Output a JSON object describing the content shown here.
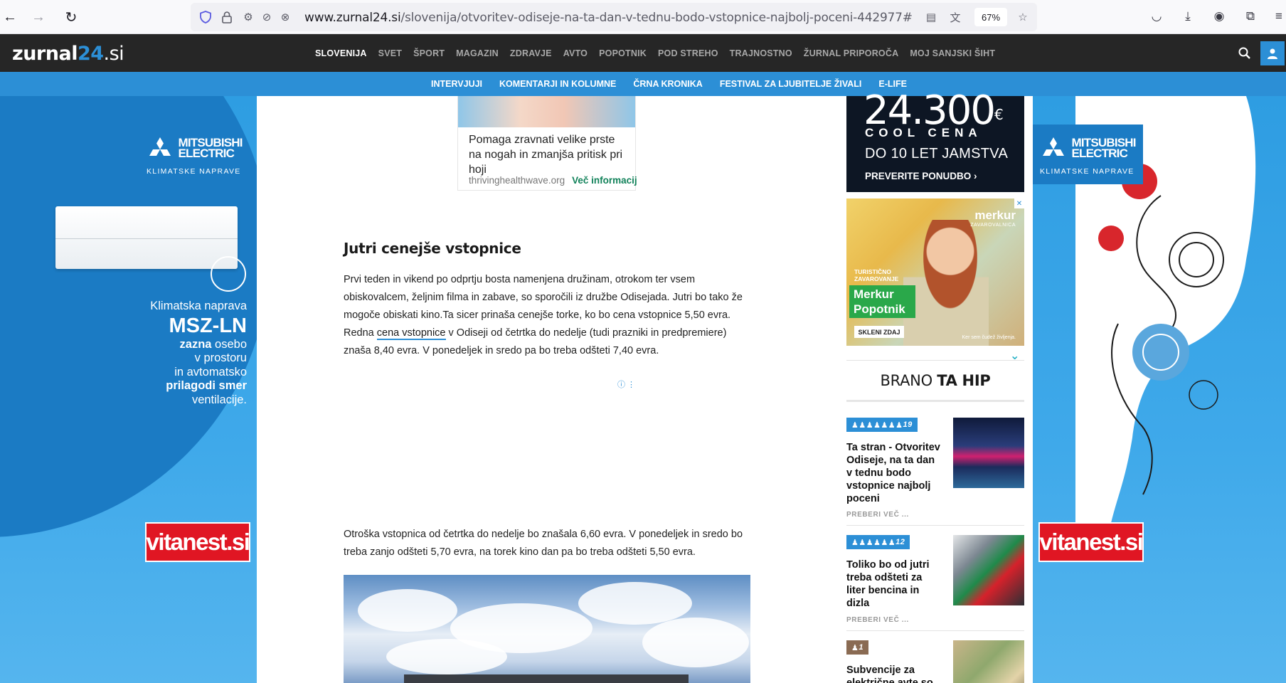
{
  "browser": {
    "url_host": "www.zurnal24.si",
    "url_path": "/slovenija/otvoritev-odiseje-na-ta-dan-v-tednu-bodo-vstopnice-najbolj-poceni-442977#google_",
    "zoom": "67%"
  },
  "site": {
    "logo_main": "zurnal",
    "logo_num": "24",
    "logo_tld": ".si",
    "nav": [
      "SLOVENIJA",
      "SVET",
      "ŠPORT",
      "MAGAZIN",
      "ZDRAVJE",
      "AVTO",
      "POPOTNIK",
      "POD STREHO",
      "TRAJNOSTNO",
      "ŽURNAL PRIPOROČA",
      "MOJ SANJSKI ŠIHT"
    ],
    "subnav": [
      "INTERVJUJI",
      "KOMENTARJI IN KOLUMNE",
      "ČRNA KRONIKA",
      "FESTIVAL ZA LJUBITELJE ŽIVALI",
      "E-LIFE"
    ]
  },
  "left_ad": {
    "brand_line1": "MITSUBISHI",
    "brand_line2": "ELECTRIC",
    "brand_sub": "KLIMATSKE NAPRAVE",
    "line1": "Klimatska naprava",
    "model": "MSZ-LN",
    "line3_bold": "zazna",
    "line3_rest": " osebo",
    "line4": "v prostoru",
    "line5": "in avtomatsko",
    "line6": "prilagodi smer",
    "line7": "ventilacije.",
    "vitanest": "vitanest.si"
  },
  "right_ad": {
    "brand_line1": "MITSUBISHI",
    "brand_line2": "ELECTRIC",
    "brand_sub": "KLIMATSKE NAPRAVE",
    "vitanest": "vitanest.si"
  },
  "native_ad": {
    "text": "Pomaga zravnati velike prste na nogah in zmanjša pritisk pri hoji",
    "source": "thrivinghealthwave.org",
    "cta": "Več informacij"
  },
  "article": {
    "heading": "Jutri cenejše vstopnice",
    "para1_before": "Prvi teden in vikend po odprtju bosta namenjena družinam, otrokom ter vsem obiskovalcem, željnim filma in zabave, so sporočili iz družbe Odisejada. Jutri bo tako že mogoče obiskati kino.Ta sicer prinaša cenejše torke, ko bo cena vstopnice 5,50 evra. Redna ",
    "para1_link": "cena vstopnice",
    "para1_after": " v Odiseji od četrtka do nedelje (tudi prazniki in predpremiere) znaša 8,40 evra. V ponedeljek in sredo pa bo treba odšteti 7,40 evra.",
    "para2": "Otroška vstopnica od četrtka do nedelje bo znašala 6,60 evra. V ponedeljek in sredo bo treba zanjo odšteti 5,70 evra, na torek kino dan pa bo treba odšteti 5,50 evra."
  },
  "sidebar": {
    "ad_top": {
      "price": "24.300",
      "currency": "€",
      "cool": "COOL CENA",
      "warranty": "DO 10 LET JAMSTVA",
      "cta": "PREVERITE PONUDBO ›"
    },
    "ad_merkur": {
      "brand": "merkur",
      "brand_sub": "ZAVAROVALNICA",
      "tz_line1": "TURISTIČNO",
      "tz_line2": "ZAVAROVANJE",
      "green_line1": "Merkur",
      "green_line2": "Popotnik",
      "button": "SKLENI ZDAJ",
      "tagline": "Ker sem čudež življenja."
    },
    "brano_light": "BRANO ",
    "brano_bold": "TA HIP",
    "items": [
      {
        "badge": "19",
        "title": "Ta stran - Otvoritev Odiseje, na ta dan v tednu bodo vstopnice najbolj poceni",
        "more": "PREBERI VEČ ..."
      },
      {
        "badge": "12",
        "title": "Toliko bo od jutri treba odšteti za liter bencina in dizla",
        "more": "PREBERI VEČ ..."
      },
      {
        "badge": "1",
        "title": "Subvencije za električne avte so"
      }
    ]
  }
}
